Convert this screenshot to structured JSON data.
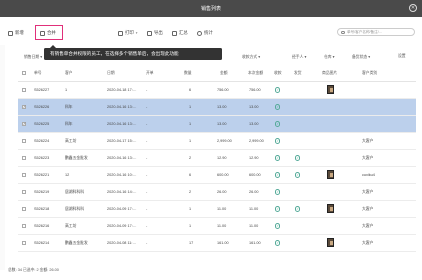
{
  "window": {
    "title": "销售列表",
    "close": "✕"
  },
  "toolbar": {
    "new": "新增",
    "merge": "合并",
    "print": "打印",
    "export": "导出",
    "summary": "汇总",
    "stats": "统计",
    "search_placeholder": "单号/客户名称/备注/…"
  },
  "tooltip": "有销售单合并权限的员工，在选择多个销售单后，会出现此功能",
  "filters": [
    "销售日期 ▾",
    "单号 ▾",
    "客户 ▾",
    "商品 ▾",
    "备注 ▾",
    "状态 ▾",
    "收款方式 ▾",
    "经手人 ▾",
    "仓库 ▾",
    "备货状态 ▾",
    "设置"
  ],
  "columns": [
    "单号",
    "客户",
    "日期",
    "开单",
    "数量",
    "金额",
    "本次金额",
    "收款",
    "发货",
    "商品图片",
    "客户类别"
  ],
  "rows": [
    {
      "id": "S526227",
      "customer": "1",
      "date": "2020-04-18 17:…",
      "creator": "-",
      "qty": "6",
      "amount": "756.00",
      "paid": "756.00",
      "recv": "✓",
      "ship": "",
      "img": true,
      "type": "",
      "selected": false
    },
    {
      "id": "S526226",
      "customer": "科年",
      "date": "2020-04-16 13:…",
      "creator": "-",
      "qty": "1",
      "amount": "13.00",
      "paid": "13.00",
      "recv": "✓",
      "ship": "",
      "img": false,
      "type": "",
      "selected": true
    },
    {
      "id": "S526225",
      "customer": "科年",
      "date": "2020-04-16 13:…",
      "creator": "-",
      "qty": "1",
      "amount": "13.00",
      "paid": "13.00",
      "recv": "✓",
      "ship": "",
      "img": false,
      "type": "",
      "selected": true
    },
    {
      "id": "S526224",
      "customer": "高工坊",
      "date": "2020-04-17 15:…",
      "creator": "-",
      "qty": "1",
      "amount": "2,999.00",
      "paid": "2,999.00",
      "recv": "✓",
      "ship": "",
      "img": false,
      "type": "大客户",
      "selected": false
    },
    {
      "id": "S526223",
      "customer": "鹏鑫五金批发",
      "date": "2020-04-16 13:…",
      "creator": "-",
      "qty": "2",
      "amount": "12.90",
      "paid": "12.90",
      "recv": "✓",
      "ship": "✓",
      "img": false,
      "type": "大客户",
      "selected": false
    },
    {
      "id": "S526221",
      "customer": "12",
      "date": "2020-04-16 10:…",
      "creator": "-",
      "qty": "6",
      "amount": "600.00",
      "paid": "600.00",
      "recv": "✓",
      "ship": "✓",
      "img": true,
      "type": "cuxiku4",
      "selected": false
    },
    {
      "id": "S526219",
      "customer": "居湖科科科",
      "date": "2020-04-16 14:…",
      "creator": "-",
      "qty": "2",
      "amount": "26.00",
      "paid": "26.00",
      "recv": "✓",
      "ship": "",
      "img": false,
      "type": "大客户",
      "selected": false
    },
    {
      "id": "S526218",
      "customer": "居湖科科科",
      "date": "2020-04-09 17:…",
      "creator": "-",
      "qty": "1",
      "amount": "11.00",
      "paid": "11.00",
      "recv": "✓",
      "ship": "✓",
      "img": true,
      "type": "大客户",
      "selected": false
    },
    {
      "id": "S526216",
      "customer": "高工坊",
      "date": "2020-04-09 17:…",
      "creator": "-",
      "qty": "1",
      "amount": "11.00",
      "paid": "11.00",
      "recv": "✓",
      "ship": "",
      "img": false,
      "type": "大客户",
      "selected": false
    },
    {
      "id": "S526214",
      "customer": "鹏鑫五金批发",
      "date": "2020-04-08 11:…",
      "creator": "-",
      "qty": "17",
      "amount": "161.00",
      "paid": "161.00",
      "recv": "✓",
      "ship": "",
      "img": true,
      "type": "大客户",
      "selected": false
    }
  ],
  "footer": {
    "text": "总数: 34   已选中: 2   金额: 26.00"
  }
}
